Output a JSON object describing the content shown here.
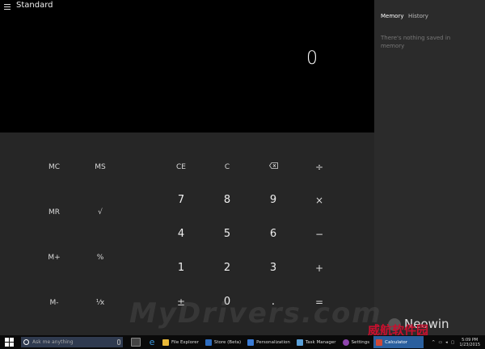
{
  "calculator": {
    "mode_title": "Standard",
    "display_value": "0",
    "memory_buttons": [
      "MC",
      "MS",
      "MR",
      "√",
      "M+",
      "%",
      "M-",
      "¹⁄x"
    ],
    "keypad": [
      [
        "CE",
        "C",
        "backspace-icon",
        "÷"
      ],
      [
        "7",
        "8",
        "9",
        "×"
      ],
      [
        "4",
        "5",
        "6",
        "−"
      ],
      [
        "1",
        "2",
        "3",
        "+"
      ],
      [
        "±",
        "0",
        ".",
        "="
      ]
    ]
  },
  "panel": {
    "tab_memory": "Memory",
    "tab_history": "History",
    "empty_message": "There's nothing saved in memory"
  },
  "watermarks": {
    "site": "MyDrivers.com",
    "brand": "Neowin",
    "chinese": "威航软件园"
  },
  "taskbar": {
    "search_placeholder": "Ask me anything",
    "tasks": [
      {
        "label": "File Explorer",
        "color": "#e8b838"
      },
      {
        "label": "Store (Beta)",
        "color": "#2d6cbf"
      },
      {
        "label": "Personalization",
        "color": "#3a7bd5"
      },
      {
        "label": "Task Manager",
        "color": "#5aa0d8"
      },
      {
        "label": "Settings",
        "color": "#8e44ad"
      },
      {
        "label": "Calculator",
        "color": "#d14836",
        "active": true
      }
    ],
    "clock_time": "5:09 PM",
    "clock_date": "1/23/2015"
  },
  "colors": {
    "display_bg": "#000000",
    "keypad_bg": "#262626",
    "panel_bg": "#2b2b2b",
    "taskbar_active": "#2a5f9e"
  }
}
